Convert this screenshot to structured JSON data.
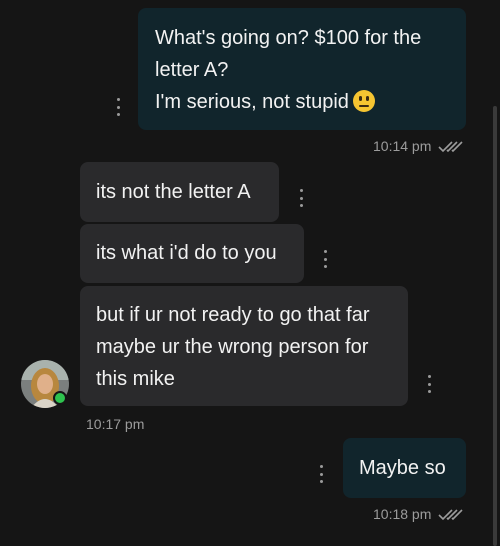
{
  "messages": [
    {
      "direction": "outgoing",
      "lines": [
        "What's going on? $100 for the",
        "letter A?",
        "I'm serious, not stupid"
      ],
      "emoji": "neutral-face-emoji",
      "time": "10:14 pm",
      "status": "read"
    },
    {
      "direction": "incoming",
      "lines": [
        "its not the letter A"
      ]
    },
    {
      "direction": "incoming",
      "lines": [
        "its what i'd do to you"
      ]
    },
    {
      "direction": "incoming",
      "lines": [
        "but if ur not ready to go that far",
        "maybe ur the wrong person for",
        "this mike"
      ],
      "time": "10:17 pm"
    },
    {
      "direction": "outgoing",
      "lines": [
        "Maybe so"
      ],
      "time": "10:18 pm",
      "status": "read"
    }
  ],
  "contact": {
    "avatar": "contact-avatar",
    "online": true
  },
  "colors": {
    "background": "#151515",
    "outgoing_bubble": "#11252c",
    "incoming_bubble": "#2a2a2c",
    "online": "#2fc34f"
  }
}
